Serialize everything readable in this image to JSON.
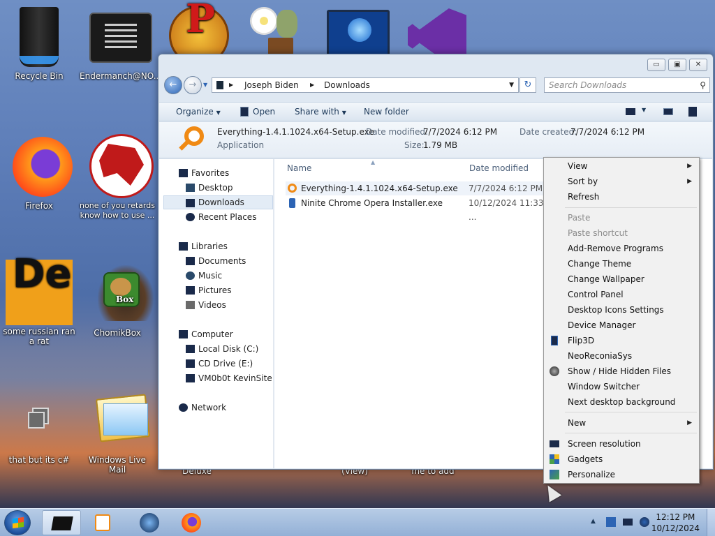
{
  "desktop": {
    "icons": [
      {
        "label": "Recycle Bin",
        "icon": "recycle-bin-icon"
      },
      {
        "label": "Endermanch@NO...",
        "icon": "terminal-icon"
      },
      {
        "label": "",
        "icon": "p-logo-icon"
      },
      {
        "label": "",
        "icon": "plant-zombie-icon"
      },
      {
        "label": "",
        "icon": "monitor-globe-icon"
      },
      {
        "label": "",
        "icon": "visual-studio-icon"
      },
      {
        "label": "Firefox",
        "icon": "firefox-icon"
      },
      {
        "label": "none of you retards know how to use ...",
        "icon": "dragon-icon"
      },
      {
        "label": "some russian ran a rat",
        "icon": "de-icon"
      },
      {
        "label": "ChomikBox",
        "icon": "hamster-icon"
      },
      {
        "label": "that but its c#",
        "icon": "windows-stack-icon"
      },
      {
        "label": "Windows Live Mail",
        "icon": "mail-icon"
      }
    ],
    "bottom_texts": [
      "Deluxe",
      "(View)",
      "me to add"
    ]
  },
  "explorer": {
    "caption_buttons": [
      "▭",
      "▣",
      "✕"
    ],
    "breadcrumb": [
      "Joseph Biden",
      "Downloads"
    ],
    "search_placeholder": "Search Downloads",
    "toolbar": {
      "organize": "Organize",
      "open": "Open",
      "share_with": "Share with",
      "new_folder": "New folder"
    },
    "details": {
      "filename": "Everything-1.4.1.1024.x64-Setup.exe",
      "type": "Application",
      "date_modified_label": "Date modified:",
      "date_modified": "7/7/2024 6:12 PM",
      "date_created_label": "Date created:",
      "date_created": "7/7/2024 6:12 PM",
      "size_label": "Size:",
      "size": "1.79 MB"
    },
    "nav": {
      "favorites": "Favorites",
      "desktop": "Desktop",
      "downloads": "Downloads",
      "recent_places": "Recent Places",
      "libraries": "Libraries",
      "documents": "Documents",
      "music": "Music",
      "pictures": "Pictures",
      "videos": "Videos",
      "computer": "Computer",
      "local_disk": "Local Disk (C:)",
      "cd_drive": "CD Drive (E:)",
      "vm_site": "VM0b0t KevinSite",
      "network": "Network"
    },
    "columns": {
      "name": "Name",
      "date_modified": "Date modified"
    },
    "files": [
      {
        "name": "Everything-1.4.1.1024.x64-Setup.exe",
        "date": "7/7/2024 6:12 PM"
      },
      {
        "name": "Ninite Chrome Opera Installer.exe",
        "date": "10/12/2024 11:33 ..."
      }
    ]
  },
  "context_menu": {
    "view": "View",
    "sort_by": "Sort by",
    "refresh": "Refresh",
    "paste": "Paste",
    "paste_shortcut": "Paste shortcut",
    "add_remove": "Add-Remove Programs",
    "change_theme": "Change Theme",
    "change_wallpaper": "Change Wallpaper",
    "control_panel": "Control Panel",
    "desktop_icons_settings": "Desktop Icons Settings",
    "device_manager": "Device Manager",
    "flip3d": "Flip3D",
    "neoreconia": "NeoReconiaSys",
    "show_hide": "Show / Hide Hidden Files",
    "window_switcher": "Window Switcher",
    "next_bg": "Next desktop background",
    "new": "New",
    "screen_resolution": "Screen resolution",
    "gadgets": "Gadgets",
    "personalize": "Personalize"
  },
  "taskbar": {
    "time": "12:12 PM",
    "date": "10/12/2024",
    "tray_up": "▲"
  }
}
